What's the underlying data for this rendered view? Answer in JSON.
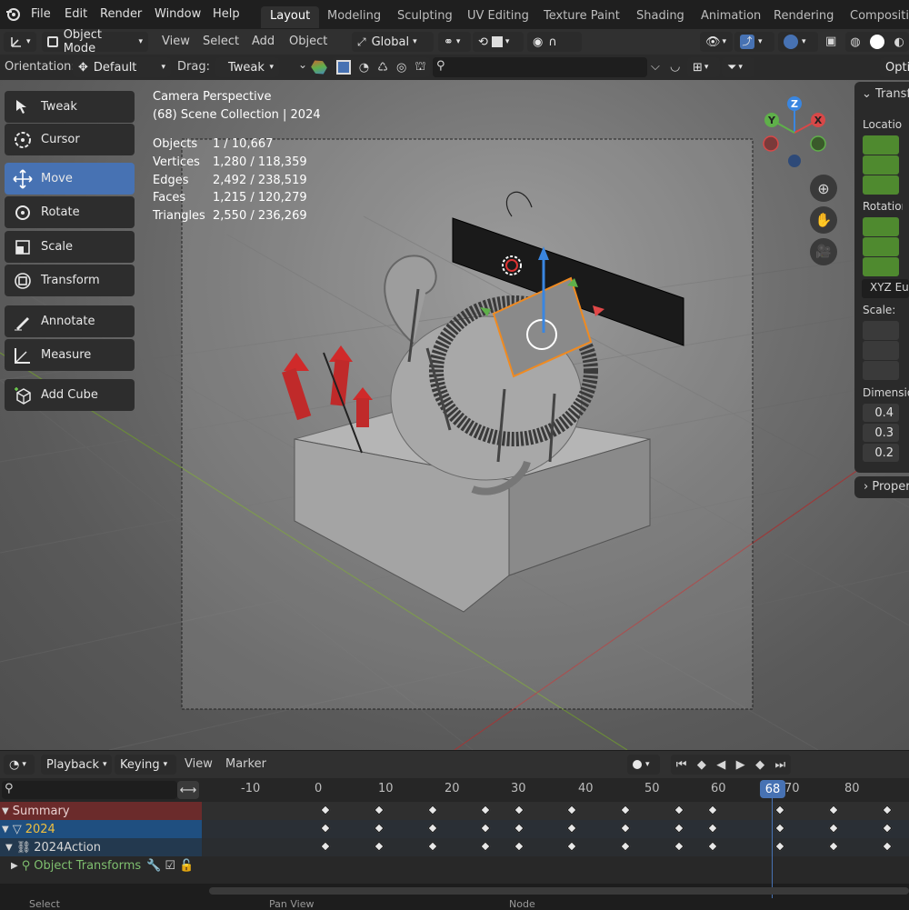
{
  "app": {
    "name": "Blender"
  },
  "menu": {
    "file": "File",
    "edit": "Edit",
    "render": "Render",
    "window": "Window",
    "help": "Help"
  },
  "workspaces": [
    "Layout",
    "Modeling",
    "Sculpting",
    "UV Editing",
    "Texture Paint",
    "Shading",
    "Animation",
    "Rendering",
    "Compositing"
  ],
  "header": {
    "mode": "Object Mode",
    "view": "View",
    "select": "Select",
    "add": "Add",
    "object": "Object",
    "transform_orientation": "Global"
  },
  "tool_settings": {
    "orientation_label": "Orientation:",
    "orientation_value": "Default",
    "drag_label": "Drag:",
    "drag_value": "Tweak",
    "search_placeholder": ""
  },
  "toolbar": {
    "tweak": "Tweak",
    "cursor": "Cursor",
    "move": "Move",
    "rotate": "Rotate",
    "scale": "Scale",
    "transform": "Transform",
    "annotate": "Annotate",
    "measure": "Measure",
    "add_cube": "Add Cube"
  },
  "viewport": {
    "view_name": "Camera Perspective",
    "collection": "(68) Scene Collection | 2024",
    "stats": [
      {
        "label": "Objects",
        "value": "1 / 10,667"
      },
      {
        "label": "Vertices",
        "value": "1,280 / 118,359"
      },
      {
        "label": "Edges",
        "value": "2,492 / 238,519"
      },
      {
        "label": "Faces",
        "value": "1,215 / 120,279"
      },
      {
        "label": "Triangles",
        "value": "2,550 / 236,269"
      }
    ],
    "gizmo": {
      "z": "Z",
      "y": "Y",
      "x": "X"
    }
  },
  "npanel": {
    "transform_header": "Transform",
    "location_label": "Location:",
    "rotation_label": "Rotation:",
    "rotation_mode": "XYZ Euler",
    "scale_label": "Scale:",
    "dimensions_label": "Dimensions:",
    "dimensions": [
      "0.4",
      "0.3",
      "0.2"
    ],
    "properties_header": "Properties"
  },
  "timeline": {
    "playback": "Playback",
    "keying": "Keying",
    "view": "View",
    "marker": "Marker",
    "current_frame": "68",
    "ruler": [
      "-10",
      "0",
      "10",
      "20",
      "30",
      "40",
      "50",
      "60",
      "70",
      "80"
    ],
    "channels": {
      "summary": "Summary",
      "object": "2024",
      "action": "2024Action",
      "group": "Object Transforms"
    }
  },
  "statusbar": {
    "select": "Select",
    "pan": "Pan View",
    "node": "Node"
  },
  "colors": {
    "accent": "#4772b3",
    "green_field": "#4f8a2f",
    "summary_row": "#6b2b2b",
    "object_row": "#1f4f80"
  }
}
